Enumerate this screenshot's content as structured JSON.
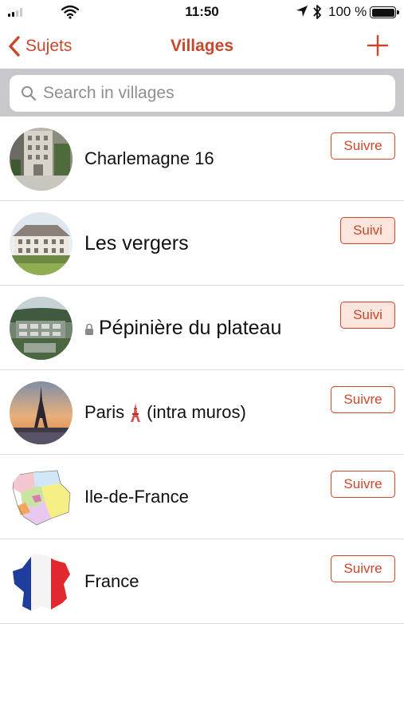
{
  "status_bar": {
    "time": "11:50",
    "battery": "100 %",
    "signal_bars": 4,
    "signal_bars_active": 2
  },
  "nav": {
    "back_label": "Sujets",
    "title": "Villages",
    "add_icon": "plus-icon",
    "accent_color": "#c9472a"
  },
  "search": {
    "placeholder": "Search in villages",
    "value": ""
  },
  "villages": [
    {
      "name": "Charlemagne 16",
      "button": "Suivre",
      "following": false,
      "locked": false,
      "icon": ""
    },
    {
      "name": "Les vergers",
      "button": "Suivi",
      "following": true,
      "locked": false,
      "icon": ""
    },
    {
      "name": "Pépinière du plateau",
      "button": "Suivi",
      "following": true,
      "locked": true,
      "icon": "lock-icon"
    },
    {
      "name_before": "Paris",
      "name_after": "(intra muros)",
      "button": "Suivre",
      "following": false,
      "locked": false,
      "icon": "tower-icon"
    },
    {
      "name": "Ile-de-France",
      "button": "Suivre",
      "following": false,
      "locked": false,
      "icon": ""
    },
    {
      "name": "France",
      "button": "Suivre",
      "following": false,
      "locked": false,
      "icon": ""
    }
  ],
  "colors": {
    "accent": "#c9472a",
    "following_bg": "#fbe5dd",
    "search_bar_bg": "#c8c7cc",
    "divider": "#dcdcdc"
  }
}
